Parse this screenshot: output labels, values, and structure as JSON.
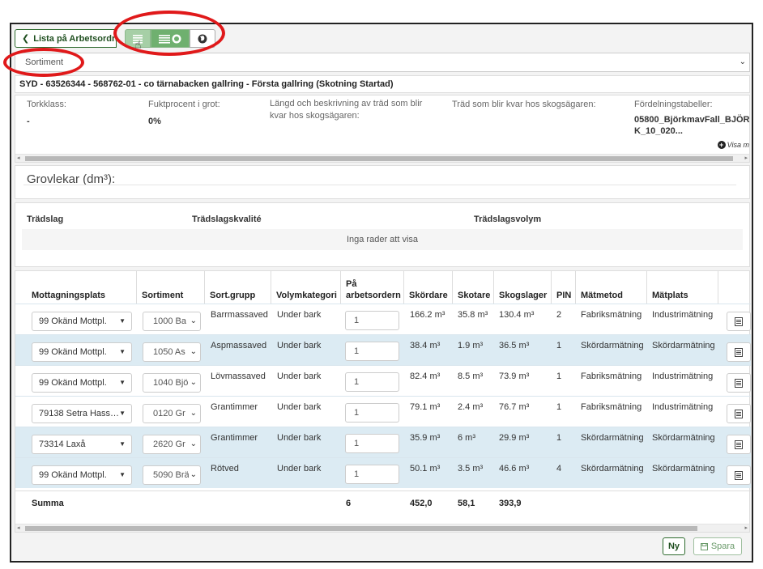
{
  "toolbar": {
    "back_label": "Lista på Arbetsordrar",
    "view_buttons": [
      "list-view-icon",
      "list-map-view-icon",
      "globe-icon"
    ]
  },
  "sortiment_select": {
    "value": "Sortiment"
  },
  "order_title": "SYD - 63526344 - 568762-01 - co tärnabacken gallring - Första gallring (Skotning Startad)",
  "info": {
    "torkklass_label": "Torkklass:",
    "torkklass_value": "-",
    "fukt_label": "Fuktprocent i grot:",
    "fukt_value": "0%",
    "langd_label": "Längd och beskrivning av träd som blir kvar hos skogsägaren:",
    "trad_label": "Träd som blir kvar hos skogsägaren:",
    "fordelning_label": "Fördelningstabeller:",
    "fordelning_value": "05800_BjörkmavFall_BJÖRK_10_020...",
    "visa_more": "Visa m"
  },
  "grovlekar": {
    "title": "Grovlekar (dm³):"
  },
  "tradslag": {
    "headers": [
      "Trädslag",
      "Trädslagskvalité",
      "Trädslagsvolym"
    ],
    "empty_text": "Inga rader att visa"
  },
  "table": {
    "headers": {
      "mottagningsplats": "Mottagningsplats",
      "sortiment": "Sortiment",
      "sortgrupp": "Sort.grupp",
      "volymkategori": "Volymkategori",
      "pa_arbetsordern": "På arbetsordern",
      "skordare": "Skördare",
      "skotare": "Skotare",
      "skogslager": "Skogslager",
      "pin": "PIN",
      "matmetod": "Mätmetod",
      "matplats": "Mätplats"
    },
    "rows": [
      {
        "mottagning": "99 Okänd Mottpl.",
        "sortiment": "1000 Ba",
        "sortgrupp": "Barrmassaved",
        "volym": "Under bark",
        "antal": "1",
        "skordare": "166.2 m³",
        "skotare": "35.8 m³",
        "skogslager": "130.4 m³",
        "pin": "2",
        "matmetod": "Fabriksmätning",
        "matplats": "Industrimätning"
      },
      {
        "mottagning": "99 Okänd Mottpl.",
        "sortiment": "1050 As",
        "sortgrupp": "Aspmassaved",
        "volym": "Under bark",
        "antal": "1",
        "skordare": "38.4 m³",
        "skotare": "1.9 m³",
        "skogslager": "36.5 m³",
        "pin": "1",
        "matmetod": "Skördarmätning",
        "matplats": "Skördarmätning"
      },
      {
        "mottagning": "99 Okänd Mottpl.",
        "sortiment": "1040 Bjö",
        "sortgrupp": "Lövmassaved",
        "volym": "Under bark",
        "antal": "1",
        "skordare": "82.4 m³",
        "skotare": "8.5 m³",
        "skogslager": "73.9 m³",
        "pin": "1",
        "matmetod": "Fabriksmätning",
        "matplats": "Industrimätning"
      },
      {
        "mottagning": "79138 Setra Hass…",
        "sortiment": "0120 Gr",
        "sortgrupp": "Grantimmer",
        "volym": "Under bark",
        "antal": "1",
        "skordare": "79.1 m³",
        "skotare": "2.4 m³",
        "skogslager": "76.7 m³",
        "pin": "1",
        "matmetod": "Fabriksmätning",
        "matplats": "Industrimätning"
      },
      {
        "mottagning": "73314 Laxå",
        "sortiment": "2620 Gr",
        "sortgrupp": "Grantimmer",
        "volym": "Under bark",
        "antal": "1",
        "skordare": "35.9 m³",
        "skotare": "6 m³",
        "skogslager": "29.9 m³",
        "pin": "1",
        "matmetod": "Skördarmätning",
        "matplats": "Skördarmätning"
      },
      {
        "mottagning": "99 Okänd Mottpl.",
        "sortiment": "5090 Brä",
        "sortgrupp": "Rötved",
        "volym": "Under bark",
        "antal": "1",
        "skordare": "50.1 m³",
        "skotare": "3.5 m³",
        "skogslager": "46.6 m³",
        "pin": "4",
        "matmetod": "Skördarmätning",
        "matplats": "Skördarmätning"
      }
    ],
    "summa": {
      "label": "Summa",
      "antal": "6",
      "skordare": "452,0",
      "skotare": "58,1",
      "skogslager": "393,9"
    }
  },
  "footer": {
    "ny_label": "Ny",
    "spara_label": "Spara"
  },
  "colors": {
    "accent": "#2e6b2e",
    "annotation": "#e0191a",
    "row_alt": "#dcebf3"
  }
}
